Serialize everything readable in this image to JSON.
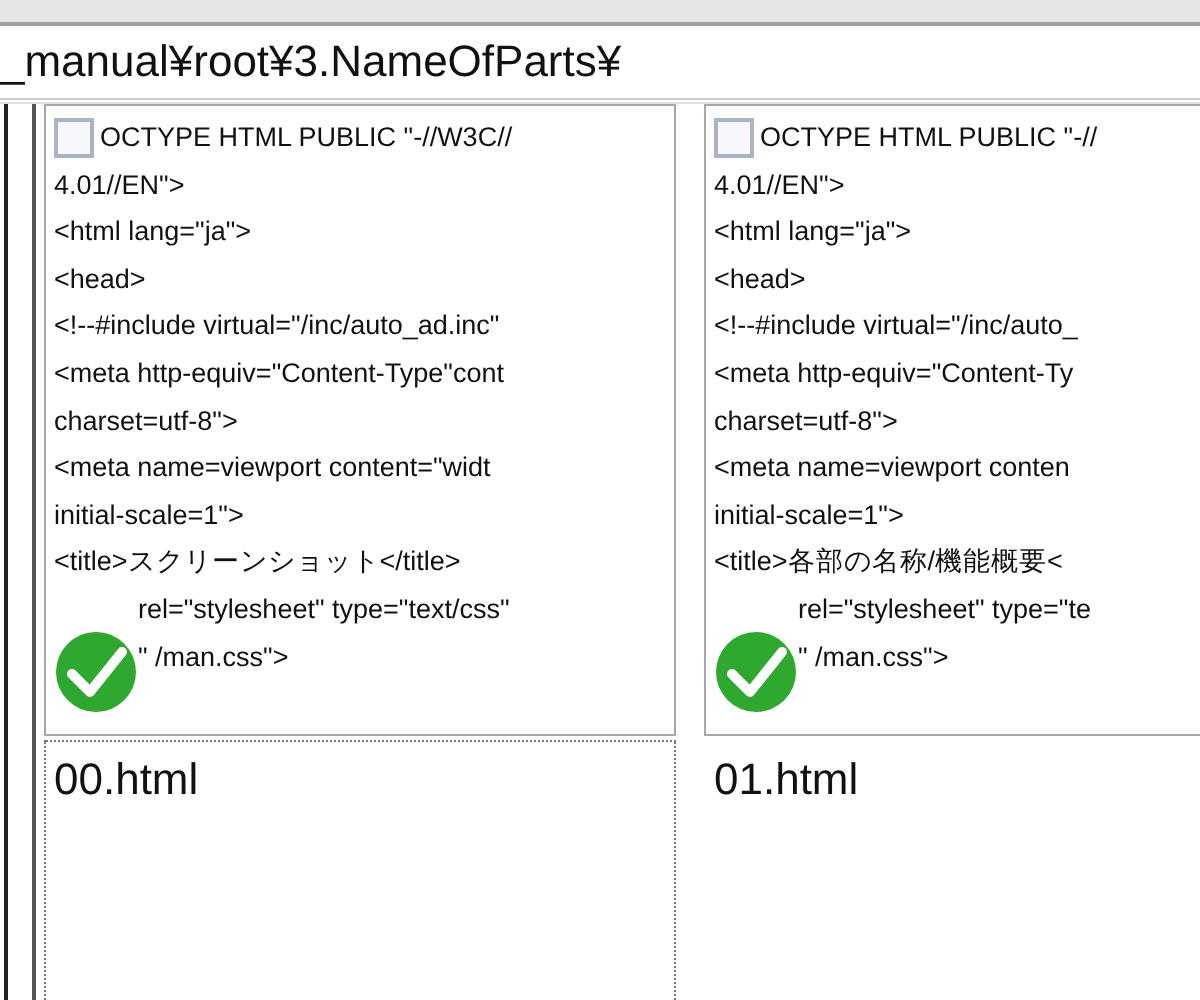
{
  "address_bar": {
    "path": "_manual¥root¥3.NameOfParts¥"
  },
  "files": [
    {
      "name": "00.html",
      "focused": true,
      "synced": true,
      "preview_lines": [
        "OCTYPE HTML PUBLIC \"-//W3C//",
        "4.01//EN\">",
        "<html lang=\"ja\">",
        "<head>",
        "<!--#include virtual=\"/inc/auto_ad.inc\"",
        "<meta http-equiv=\"Content-Type\"cont",
        "charset=utf-8\">",
        "<meta name=viewport content=\"widt",
        "initial-scale=1\">",
        "<title>スクリーンショット</title>",
        "rel=\"stylesheet\" type=\"text/css\"",
        "\" /man.css\">"
      ]
    },
    {
      "name": "01.html",
      "focused": false,
      "synced": true,
      "preview_lines": [
        "OCTYPE HTML PUBLIC \"-//",
        "4.01//EN\">",
        "<html lang=\"ja\">",
        "<head>",
        "<!--#include virtual=\"/inc/auto_",
        "<meta http-equiv=\"Content-Ty",
        "charset=utf-8\">",
        "<meta name=viewport conten",
        "initial-scale=1\">",
        "<title>各部の名称/機能概要<",
        "rel=\"stylesheet\" type=\"te",
        "\" /man.css\">"
      ]
    }
  ]
}
